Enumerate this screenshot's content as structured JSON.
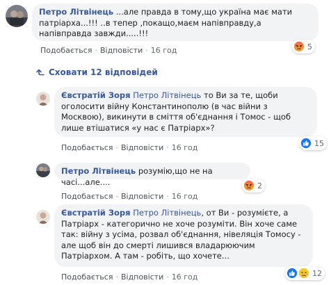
{
  "colors": {
    "link": "#385898",
    "bubble": "#f2f3f5",
    "meta": "#606770",
    "like_blue": "#1877f2",
    "angry_orange": "#f0654d"
  },
  "actions": {
    "like": "Подобається",
    "reply": "Відповісти",
    "separator": "·"
  },
  "top_comment": {
    "author": "Петро Літвінець",
    "text": "...але правда в тому,що україна має мати патріарха...!!! ..в тепер ,покащо,маєм напівправду,а напівправда завжди.....!!!",
    "time": "16 год",
    "reactions": {
      "icons": [
        "angry-icon"
      ],
      "count": "5"
    }
  },
  "hide_replies": {
    "label": "Сховати 12 відповідей",
    "icon": "curved-arrow-up-icon"
  },
  "replies": [
    {
      "author": "Євстратій Зоря",
      "mention": "Петро Літвінець",
      "text": "то Ви за те, щоби оголосити війну Константинополю (в час війни з Москвою), викинути в сміття об'єднання і Томос - щоб лише втішатися «у нас є Патріарх»?",
      "time": "16 год",
      "reactions": {
        "icons": [
          "like-icon"
        ],
        "count": "15"
      }
    },
    {
      "author": "Петро Літвінець",
      "mention": "",
      "text": "розумію,що не на часі...але....",
      "time": "16 год",
      "reactions": {
        "icons": [
          "angry-icon"
        ],
        "count": "2"
      }
    },
    {
      "author": "Євстратій Зоря",
      "mention": "Петро Літвінець",
      "text": ", от Ви - розумієте, а Патріарх - категорично не хоче розуміти. Він хоче саме так: війну з усіма, розвал об'єднання, нівеляція Томосу - але щоб він до смерті лишився владарюючим Патріархом. А там - робіть, що хочете...",
      "time": "16 год",
      "reactions": {
        "icons": [
          "like-icon",
          "sad-icon"
        ],
        "count": "12"
      }
    }
  ]
}
